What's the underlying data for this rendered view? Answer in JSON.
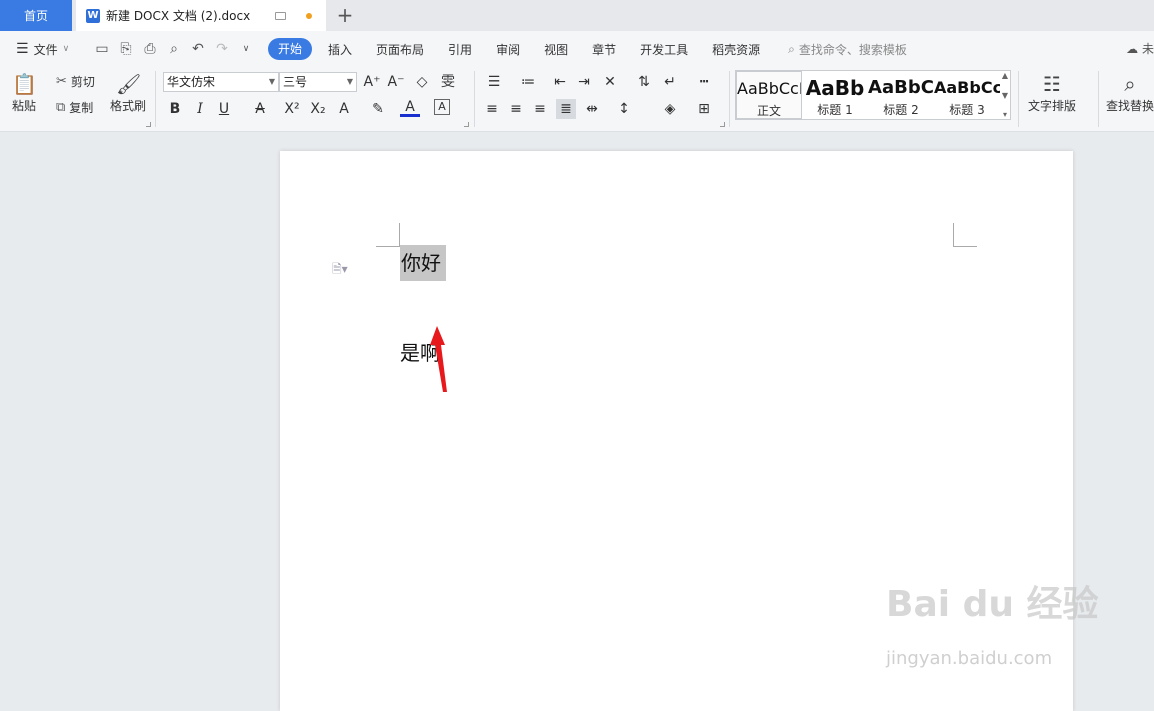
{
  "tabs": {
    "home": "首页",
    "doc_title": "新建 DOCX 文档 (2).docx",
    "doc_icon": "W",
    "add": "+"
  },
  "menu": {
    "file": "文件",
    "items": [
      "开始",
      "插入",
      "页面布局",
      "引用",
      "审阅",
      "视图",
      "章节",
      "开发工具",
      "稻壳资源"
    ],
    "search_placeholder": "查找命令、搜索模板",
    "cloud": "未"
  },
  "ribbon": {
    "paste": "粘贴",
    "cut": "剪切",
    "copy": "复制",
    "format_painter": "格式刷",
    "font_name": "华文仿宋",
    "font_size": "三号",
    "styles": [
      {
        "sample": "AaBbCcDd",
        "label": "正文"
      },
      {
        "sample": "AaBb",
        "label": "标题 1"
      },
      {
        "sample": "AaBbC",
        "label": "标题 2"
      },
      {
        "sample": "AaBbCc",
        "label": "标题 3"
      }
    ],
    "text_layout": "文字排版",
    "find_replace": "查找替换"
  },
  "document": {
    "para1": "你好",
    "para2": "是啊"
  },
  "watermark": {
    "brand": "Bai du 经验",
    "url": "jingyan.baidu.com"
  },
  "colors": {
    "accent": "#3a7be3",
    "arrow": "#e8191c",
    "highlight": "#c6c6c6"
  }
}
